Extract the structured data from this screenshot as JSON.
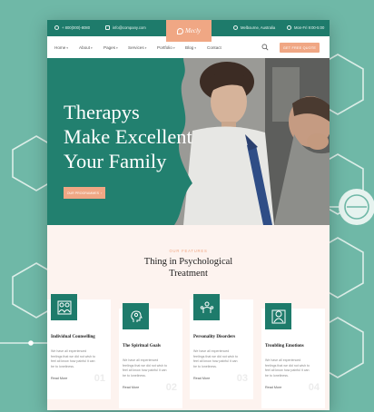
{
  "colors": {
    "brand": "#1e7b6b",
    "accent": "#f0a784",
    "background": "#6fb8a7",
    "section_bg": "#fdf3ef"
  },
  "topbar": {
    "phone": "+ 800(000)-8080",
    "email": "info@company.com",
    "location": "Melbourne, Australia",
    "hours": "Mon-Fri 9:00-5:00",
    "icons": [
      "phone-icon",
      "email-icon",
      "location-icon",
      "clock-icon"
    ]
  },
  "logo": {
    "text": "Mecly",
    "icon": "logo-mark-icon"
  },
  "nav": {
    "items": [
      {
        "label": "Home"
      },
      {
        "label": "About"
      },
      {
        "label": "Pages"
      },
      {
        "label": "Services"
      },
      {
        "label": "Portfolio"
      },
      {
        "label": "Blog"
      },
      {
        "label": "Contact"
      }
    ],
    "search_icon": "search-icon",
    "cta_label": "GET FREE QUOTE"
  },
  "hero": {
    "title_lines": [
      "Therapys",
      "Make Excellent",
      "Your Family"
    ],
    "button_label": "OUR PROGRAMMES"
  },
  "features": {
    "eyebrow": "OUR FEATURES",
    "title_lines": [
      "Thing in Psychological",
      "Treatment"
    ],
    "cards": [
      {
        "title": "Individual Counselling",
        "text": "We have all experienced feelings that we did not wish to feel all know how painful it can be to loneliness.",
        "more": "Read More",
        "number": "01",
        "icon": "counselling-icon"
      },
      {
        "title": "The Spiritual Goals",
        "text": "We have all experienced feelings that we did not wish to feel all know how painful it can be to loneliness.",
        "more": "Read More",
        "number": "02",
        "icon": "spiritual-head-icon"
      },
      {
        "title": "Personality Disorders",
        "text": "We have all experienced feelings that we did not wish to feel all know how painful it can be to loneliness.",
        "more": "Read More",
        "number": "03",
        "icon": "personality-icon"
      },
      {
        "title": "Troubling Emotions",
        "text": "We have all experienced feelings that we did not wish to feel all know how painful it can be to loneliness.",
        "more": "Read More",
        "number": "04",
        "icon": "emotions-icon"
      }
    ]
  }
}
